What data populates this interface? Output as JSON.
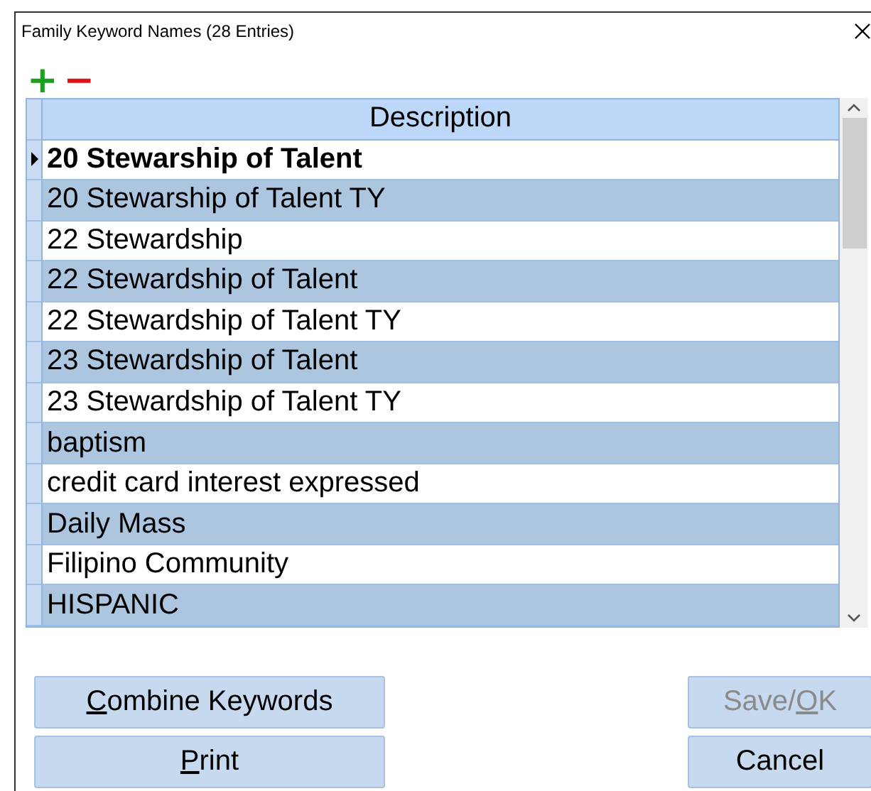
{
  "window": {
    "title": "Family Keyword Names (28 Entries)"
  },
  "toolbar": {
    "add": "+",
    "remove": "−"
  },
  "table": {
    "columns": [
      "Description"
    ],
    "rows": [
      {
        "text": "20 Stewarship of Talent",
        "selected": true
      },
      {
        "text": "20 Stewarship of Talent TY",
        "selected": false
      },
      {
        "text": "22 Stewardship",
        "selected": false
      },
      {
        "text": "22 Stewardship of Talent",
        "selected": false
      },
      {
        "text": "22 Stewardship of Talent TY",
        "selected": false
      },
      {
        "text": "23 Stewardship of Talent",
        "selected": false
      },
      {
        "text": "23 Stewardship of Talent TY",
        "selected": false
      },
      {
        "text": "baptism",
        "selected": false
      },
      {
        "text": "credit card interest expressed",
        "selected": false
      },
      {
        "text": "Daily Mass",
        "selected": false
      },
      {
        "text": "Filipino Community",
        "selected": false
      },
      {
        "text": "HISPANIC",
        "selected": false
      }
    ]
  },
  "buttons_left": [
    {
      "key": "C",
      "after": "ombine Keywords",
      "disabled": false
    },
    {
      "key": "P",
      "after": "rint",
      "disabled": false
    }
  ],
  "buttons_right": [
    {
      "before": "Save/",
      "key": "O",
      "after": "K",
      "disabled": true
    },
    {
      "before": "Cancel",
      "disabled": false
    }
  ]
}
